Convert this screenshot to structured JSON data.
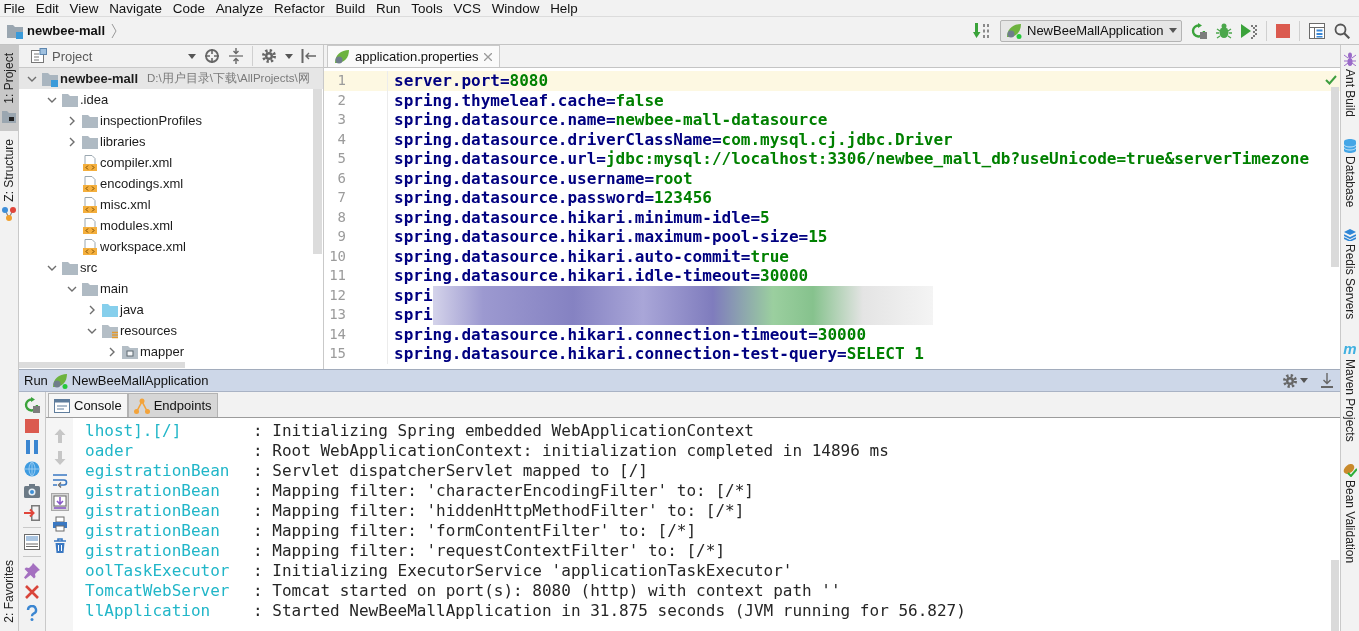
{
  "menu_bar": [
    "File",
    "Edit",
    "View",
    "Navigate",
    "Code",
    "Analyze",
    "Refactor",
    "Build",
    "Run",
    "Tools",
    "VCS",
    "Window",
    "Help"
  ],
  "navigation_bar": {
    "breadcrumb": "newbee-mall",
    "run_configuration": "NewBeeMallApplication"
  },
  "left_tool_strip": {
    "top": [
      {
        "kind": "project",
        "label": "1: Project",
        "selected": true
      },
      {
        "kind": "structure",
        "label": "Z: Structure",
        "selected": false
      }
    ],
    "bottom": [
      {
        "label": "2: Favorites",
        "selected": false
      }
    ]
  },
  "project_panel": {
    "title": "Project",
    "tree": [
      {
        "name": "newbee-mall",
        "path": "D:\\用户目录\\下载\\AllProjects\\网",
        "kind": "module",
        "expanded": true,
        "selected": true,
        "children": [
          {
            "name": ".idea",
            "kind": "folder",
            "expanded": true,
            "selected": false,
            "children": [
              {
                "name": "inspectionProfiles",
                "kind": "folder",
                "expanded": false,
                "selected": false
              },
              {
                "name": "libraries",
                "kind": "folder",
                "expanded": false,
                "selected": false
              },
              {
                "name": "compiler.xml",
                "kind": "xml",
                "selected": false
              },
              {
                "name": "encodings.xml",
                "kind": "xml",
                "selected": false
              },
              {
                "name": "misc.xml",
                "kind": "xml",
                "selected": false
              },
              {
                "name": "modules.xml",
                "kind": "xml",
                "selected": false
              },
              {
                "name": "workspace.xml",
                "kind": "xml",
                "selected": false
              }
            ]
          },
          {
            "name": "src",
            "kind": "folder",
            "expanded": true,
            "selected": false,
            "children": [
              {
                "name": "main",
                "kind": "folder",
                "expanded": true,
                "selected": false,
                "children": [
                  {
                    "name": "java",
                    "kind": "source_folder",
                    "expanded": false,
                    "selected": false
                  },
                  {
                    "name": "resources",
                    "kind": "resources_folder",
                    "expanded": true,
                    "selected": false,
                    "children": [
                      {
                        "name": "mapper",
                        "kind": "package",
                        "expanded": false,
                        "selected": false
                      }
                    ]
                  }
                ]
              }
            ]
          }
        ]
      }
    ]
  },
  "editor": {
    "tabs": [
      {
        "label": "application.properties",
        "selected": true
      }
    ],
    "lines": [
      {
        "number": "1",
        "kind": "property",
        "key": "server.port=",
        "value": "8080",
        "current": true
      },
      {
        "number": "2",
        "kind": "property",
        "key": "spring.thymeleaf.cache=",
        "value": "false",
        "current": false
      },
      {
        "number": "3",
        "kind": "property",
        "key": "spring.datasource.name=",
        "value": "newbee-mall-datasource",
        "current": false
      },
      {
        "number": "4",
        "kind": "property",
        "key": "spring.datasource.driverClassName=",
        "value": "com.mysql.cj.jdbc.Driver",
        "current": false
      },
      {
        "number": "5",
        "kind": "property",
        "key": "spring.datasource.url=",
        "value": "jdbc:mysql://localhost:3306/newbee_mall_db?useUnicode=true&serverTimezone",
        "current": false
      },
      {
        "number": "6",
        "kind": "property",
        "key": "spring.datasource.username=",
        "value": "root",
        "current": false
      },
      {
        "number": "7",
        "kind": "property",
        "key": "spring.datasource.password=",
        "value": "123456",
        "current": false
      },
      {
        "number": "8",
        "kind": "property",
        "key": "spring.datasource.hikari.minimum-idle=",
        "value": "5",
        "current": false
      },
      {
        "number": "9",
        "kind": "property",
        "key": "spring.datasource.hikari.maximum-pool-size=",
        "value": "15",
        "current": false
      },
      {
        "number": "10",
        "kind": "property",
        "key": "spring.datasource.hikari.auto-commit=",
        "value": "true",
        "current": false
      },
      {
        "number": "11",
        "kind": "property",
        "key": "spring.datasource.hikari.idle-timeout=",
        "value": "30000",
        "current": false
      },
      {
        "number": "12",
        "kind": "redacted",
        "key": "spri",
        "current": false
      },
      {
        "number": "13",
        "kind": "redacted",
        "key": "spri",
        "current": false
      },
      {
        "number": "14",
        "kind": "property",
        "key": "spring.datasource.hikari.connection-timeout=",
        "value": "30000",
        "current": false
      },
      {
        "number": "15",
        "kind": "property",
        "key": "spring.datasource.hikari.connection-test-query=",
        "value": "SELECT 1",
        "current": false
      }
    ]
  },
  "run_panel": {
    "title": "Run",
    "configuration": "NewBeeMallApplication",
    "tabs": [
      {
        "kind": "console",
        "label": "Console",
        "selected": true
      },
      {
        "kind": "endpoints",
        "label": "Endpoints",
        "selected": false
      }
    ],
    "console_toolbar": [
      {
        "kind": "scroll_up",
        "disabled": true,
        "on": false
      },
      {
        "kind": "scroll_down",
        "disabled": true,
        "on": false
      },
      {
        "kind": "soft_wrap",
        "disabled": false,
        "on": false
      },
      {
        "kind": "scroll_to_end",
        "disabled": false,
        "on": true
      },
      {
        "kind": "print",
        "disabled": false,
        "on": false
      },
      {
        "kind": "clear",
        "disabled": false,
        "on": false
      }
    ],
    "log": [
      {
        "source": "lhost].[/]",
        "message": ": Initializing Spring embedded WebApplicationContext"
      },
      {
        "source": "oader",
        "message": ": Root WebApplicationContext: initialization completed in 14896 ms"
      },
      {
        "source": "egistrationBean",
        "message": ": Servlet dispatcherServlet mapped to [/]"
      },
      {
        "source": "gistrationBean",
        "message": ": Mapping filter: 'characterEncodingFilter' to: [/*]"
      },
      {
        "source": "gistrationBean",
        "message": ": Mapping filter: 'hiddenHttpMethodFilter' to: [/*]"
      },
      {
        "source": "gistrationBean",
        "message": ": Mapping filter: 'formContentFilter' to: [/*]"
      },
      {
        "source": "gistrationBean",
        "message": ": Mapping filter: 'requestContextFilter' to: [/*]"
      },
      {
        "source": "oolTaskExecutor",
        "message": ": Initializing ExecutorService 'applicationTaskExecutor'"
      },
      {
        "source": "TomcatWebServer",
        "message": ": Tomcat started on port(s): 8080 (http) with context path ''"
      },
      {
        "source": "llApplication",
        "message": ": Started NewBeeMallApplication in 31.875 seconds (JVM running for 56.827)"
      }
    ]
  },
  "right_tool_strip": [
    {
      "kind": "ant",
      "label": "Ant Build",
      "selected": false
    },
    {
      "kind": "database",
      "label": "Database",
      "selected": false
    },
    {
      "kind": "redis",
      "label": "Redis Servers",
      "selected": false
    },
    {
      "kind": "maven",
      "glyph": "m",
      "label": "Maven Projects",
      "selected": false
    },
    {
      "kind": "bean",
      "label": "Bean Validation",
      "selected": false
    }
  ]
}
